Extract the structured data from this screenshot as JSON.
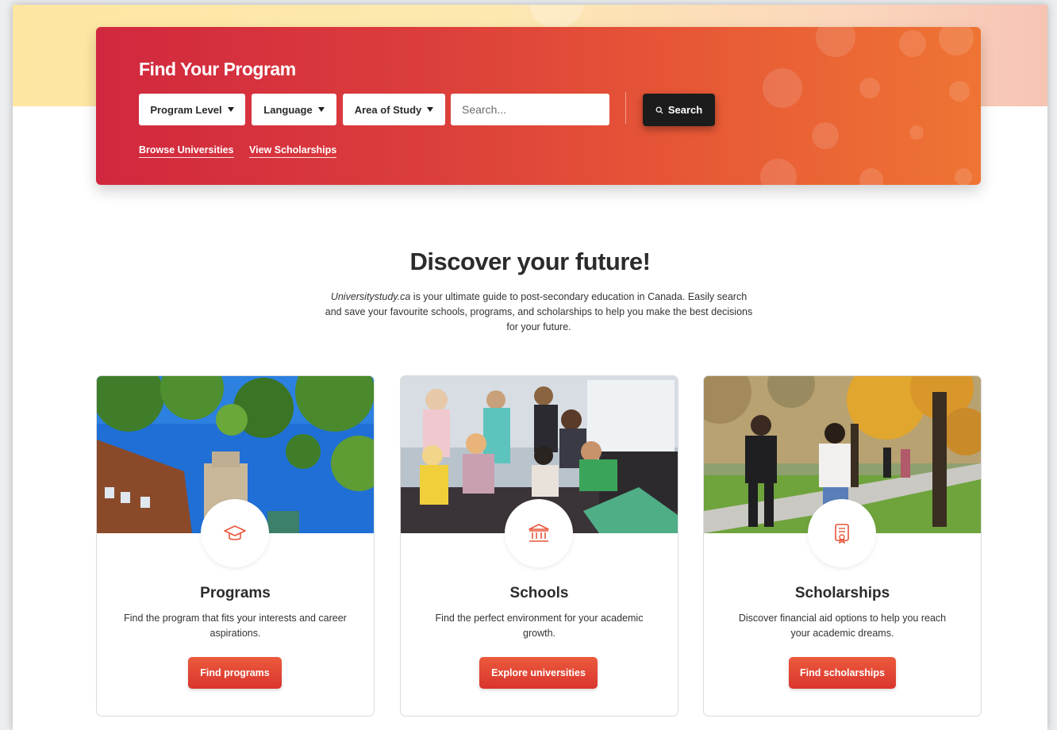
{
  "hero": {
    "title": "Find Your Program",
    "filters": [
      {
        "label": "Program Level"
      },
      {
        "label": "Language"
      },
      {
        "label": "Area of Study"
      }
    ],
    "search_placeholder": "Search...",
    "search_button": "Search",
    "links": [
      "Browse Universities",
      "View Scholarships"
    ],
    "colors": {
      "gradient_start": "#d1283f",
      "gradient_end": "#ef7434",
      "search_button": "#1c1c1c"
    }
  },
  "intro": {
    "headline": "Discover your future!",
    "site_name": "Universitystudy.ca",
    "text": " is your ultimate guide to post-secondary education in Canada. Easily search and save your favourite schools, programs, and scholarships to help you make the best decisions for your future."
  },
  "cards": [
    {
      "title": "Programs",
      "description": "Find the program that fits your interests and career aspirations.",
      "button": "Find programs",
      "icon": "graduation-cap-icon",
      "image": "university-tower-trees-photo"
    },
    {
      "title": "Schools",
      "description": "Find the perfect environment for your academic growth.",
      "button": "Explore universities",
      "icon": "institution-building-icon",
      "image": "students-lounge-photo"
    },
    {
      "title": "Scholarships",
      "description": "Discover financial aid options to help you reach your academic dreams.",
      "button": "Find scholarships",
      "icon": "certificate-icon",
      "image": "students-walking-autumn-photo"
    }
  ],
  "accent_color": "#e8553a"
}
